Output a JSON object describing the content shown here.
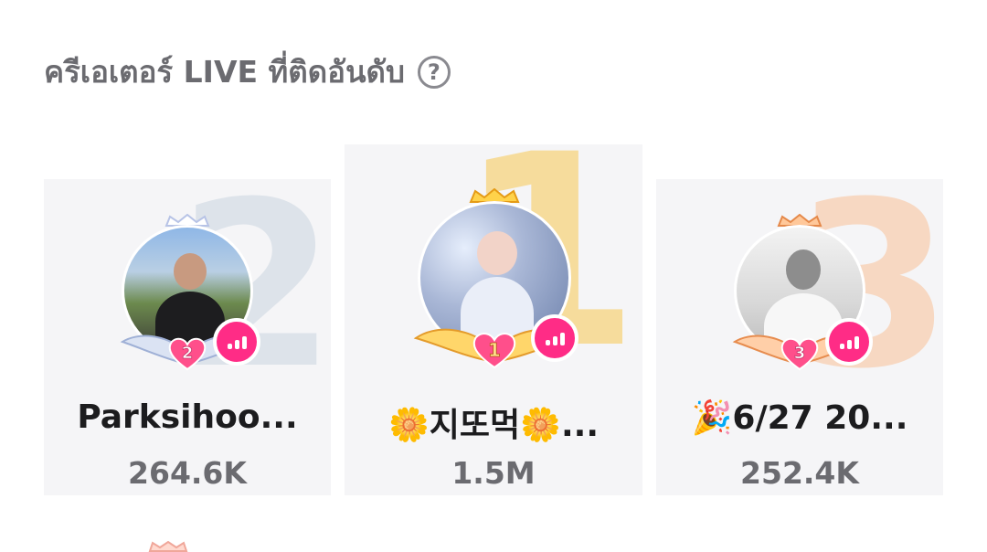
{
  "header": {
    "title": "ครีเอเตอร์ LIVE ที่ติดอันดับ",
    "help_symbol": "?"
  },
  "ranking": [
    {
      "rank": "2",
      "name": "Parksihoo...",
      "count": "264.6K",
      "rank_color": "#dde3ea",
      "crown_color": "#c9d3ee"
    },
    {
      "rank": "1",
      "name": "🌼지또먹🌼...",
      "count": "1.5M",
      "rank_color": "#f6dc9c",
      "crown_color": "#f3b932"
    },
    {
      "rank": "3",
      "name": "🎉6/27 20...",
      "count": "252.4K",
      "rank_color": "#f7d8c2",
      "crown_color": "#f3ab6b"
    }
  ],
  "colors": {
    "live_badge": "#ff2c86",
    "card_bg": "#f5f5f7",
    "heart_badge": "#ff3d7a"
  },
  "icons": {
    "help": "question-circle-icon",
    "live": "live-bars-icon",
    "crown": "crown-icon",
    "wings": "heart-wings-badge-icon"
  }
}
